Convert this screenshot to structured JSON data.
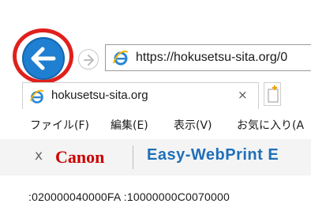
{
  "navigation": {
    "back_icon": "arrow-left-icon",
    "forward_icon": "arrow-right-icon",
    "address_url": "https://hokusetsu-sita.org/0"
  },
  "tab": {
    "title": "hokusetsu-sita.org",
    "close_glyph": "×"
  },
  "menu": {
    "items": [
      "ファイル(F)",
      "編集(E)",
      "表示(V)",
      "お気に入り(A"
    ]
  },
  "toolbar": {
    "close_glyph": "x",
    "brand": "Canon",
    "product": "Easy-WebPrint E"
  },
  "content": {
    "line": ":020000040000FA :10000000C0070000"
  },
  "colors": {
    "back_button": "#1f7fd0",
    "highlight_ring": "#e0201c",
    "canon_red": "#cc0000",
    "ewp_blue": "#1e6fb8"
  }
}
